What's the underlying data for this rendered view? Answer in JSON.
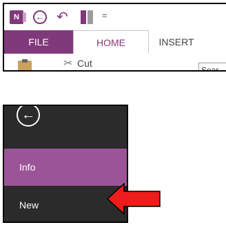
{
  "quick_access": {
    "app_icon_letter": "N",
    "back_icon": "back-arrow-circle-icon",
    "undo_icon": "undo-icon",
    "dock_icon": "dock-to-desktop-icon",
    "customize_symbol": "="
  },
  "tabs": [
    {
      "label": "FILE"
    },
    {
      "label": "HOME"
    },
    {
      "label": "INSERT"
    }
  ],
  "ribbon": {
    "cut_label": "Cut",
    "search_text": "Sear"
  },
  "backstage": {
    "back_icon": "back-arrow-circle-icon",
    "items": [
      {
        "label": "Info"
      },
      {
        "label": "New"
      }
    ]
  },
  "colors": {
    "brand_purple": "#80397b",
    "selected_purple": "#9b5497",
    "backstage_bg": "#2b2b2b",
    "arrow_red": "#ee1c1c"
  }
}
